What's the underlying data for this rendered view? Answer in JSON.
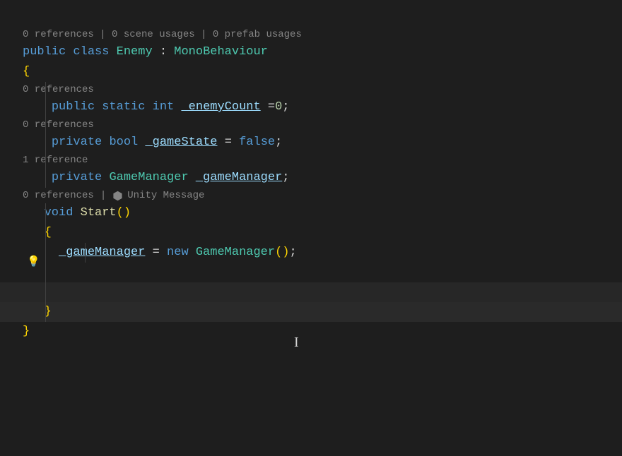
{
  "codelens": {
    "class": "0 references | 0 scene usages | 0 prefab usages",
    "enemyCount": "0 references",
    "gameState": "0 references",
    "gameManager": "1 reference",
    "start_refs": "0 references",
    "start_unity": "Unity Message"
  },
  "tokens": {
    "public": "public",
    "class": "class",
    "Enemy": "Enemy",
    "colon": ":",
    "MonoBehaviour": "MonoBehaviour",
    "openBrace": "{",
    "closeBrace": "}",
    "static": "static",
    "int": "int",
    "_enemyCount": "_enemyCount",
    "eq": "=",
    "eqNoSpace": " =",
    "zero": "0",
    "semi": ";",
    "private": "private",
    "bool": "bool",
    "_gameState": "_gameState",
    "false": "false",
    "GameManager": "GameManager",
    "_gameManager": "_gameManager",
    "void": "void",
    "Start": "Start",
    "parens": "()",
    "new": "new",
    "sep": "|"
  },
  "cursor": {
    "glyph": "I"
  }
}
